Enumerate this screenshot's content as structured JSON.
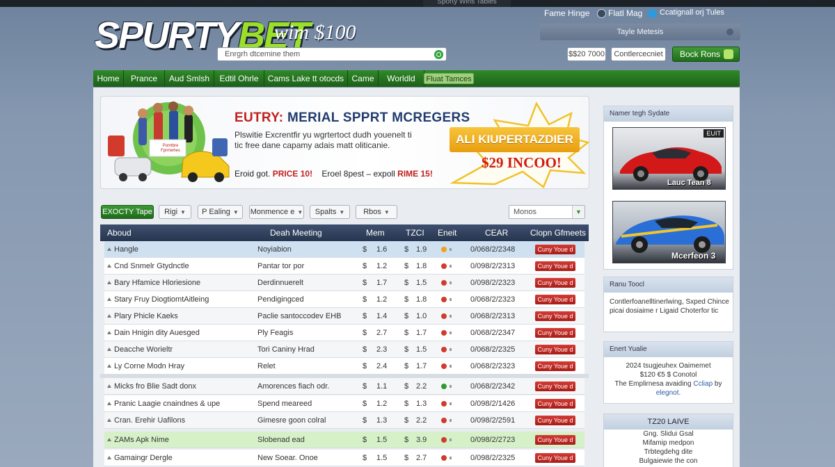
{
  "topstrip": {
    "label": "Sporty Wins Tables"
  },
  "header": {
    "logo_a": "SPURTY",
    "logo_b": "BET",
    "slogan": "wim $100",
    "search_placeholder": "Enrgrh dtcemine them",
    "links": [
      "Fame Hinge",
      "Flatl Mag",
      "Ccatignall orj Tules"
    ],
    "topbar_label": "Tayle Metesis",
    "amount_1": "$$20 7000",
    "amount_2": "Contlercecniet",
    "login_label": "Bock Rons"
  },
  "nav": [
    "Home",
    "Prance",
    "Aud Smlsh",
    "Edtil Ohrle",
    "Cams Lake tt otocds",
    "Came",
    "Worldld",
    "Fluat Tamces"
  ],
  "banner": {
    "title_a": "EUTRY:",
    "title_b": "MERIAL SPPRT MCREGERS",
    "text": "Plswitie Excrentfir yu wgrtertoct dudh youenelt ti tic free dane capamy adais matt oliticanie.",
    "price_a_label": "Eroid got.",
    "price_a": "PRICE 10!",
    "price_b_label": "Eroel 8pest – expoll",
    "price_b": "RIME 15!",
    "promo_tag": "ALI KIUPERTAZDIER",
    "promo_price": "$29 INCOO!",
    "mini_label": "Pomtbre Fprmwhes"
  },
  "filters": {
    "primary": "EXOCTY Tape",
    "buttons": [
      "Rigi",
      "P Ealing",
      "Monmence e",
      "Spalts",
      "Rbos"
    ],
    "search_value": "Monos"
  },
  "table": {
    "headers": [
      "Aboud",
      "Deah Meeting",
      "Mem",
      "TZCI",
      "Eneit",
      "CEAR",
      "Clopn Gfmeets"
    ],
    "bet_label": "Cuny Youe d",
    "rows": [
      {
        "name": "Hangle",
        "event": "Noyiabion",
        "mem": "1.6",
        "tzci": "1.9",
        "ear": "0/068/2/2348",
        "ico": "#f0a21e",
        "style": "highlight"
      },
      {
        "name": "Cnd Snmelr Gtydnctle",
        "event": "Pantar tor por",
        "mem": "1.2",
        "tzci": "1.8",
        "ear": "0/098/2/2313",
        "ico": "#d23a2e",
        "style": ""
      },
      {
        "name": "Bary Hfamice Hloriesione",
        "event": "Derdinnuerelt",
        "mem": "1.7",
        "tzci": "1.5",
        "ear": "0/098/2/2323",
        "ico": "#d23a2e",
        "style": "alt"
      },
      {
        "name": "Stary Fruy DiogtiomtAitleing",
        "event": "Pendigingced",
        "mem": "1.2",
        "tzci": "1.8",
        "ear": "0/068/2/2323",
        "ico": "#d23a2e",
        "style": ""
      },
      {
        "name": "Plary Phicle Kaeks",
        "event": "Paclie santoccodev EHB",
        "mem": "1.4",
        "tzci": "1.0",
        "ear": "0/068/2/2313",
        "ico": "#d23a2e",
        "style": "alt"
      },
      {
        "name": "Dain Hnigin dity Auesged",
        "event": "Ply Feagis",
        "mem": "2.7",
        "tzci": "1.7",
        "ear": "0/068/2/2347",
        "ico": "#d23a2e",
        "style": ""
      },
      {
        "name": "Deacche Worieltr",
        "event": "Tori Caniny Hrad",
        "mem": "2.3",
        "tzci": "1.5",
        "ear": "0/068/2/2325",
        "ico": "#d23a2e",
        "style": "alt"
      },
      {
        "name": "Ly Corne Modn Hray",
        "event": "Relet",
        "mem": "2.4",
        "tzci": "1.7",
        "ear": "0/068/2/2323",
        "ico": "#d23a2e",
        "style": ""
      },
      {
        "name": "Micks fro Blie Sadt donx",
        "event": "Amorences fiach odr.",
        "mem": "1.1",
        "tzci": "2.2",
        "ear": "0/068/2/2342",
        "ico": "#2f9a34",
        "style": "alt"
      },
      {
        "name": "Pranic Laagie cnaindnes & upe",
        "event": "Spend meareed",
        "mem": "1.2",
        "tzci": "1.3",
        "ear": "0/098/2/1426",
        "ico": "#d23a2e",
        "style": ""
      },
      {
        "name": "Cran. Erehir Uafilons",
        "event": "Gimesre goon colral",
        "mem": "1.3",
        "tzci": "2.2",
        "ear": "0/098/2/2591",
        "ico": "#d23a2e",
        "style": "alt"
      },
      {
        "name": "ZAMs Apk Nime",
        "event": "Slobenad ead",
        "mem": "1.5",
        "tzci": "3.9",
        "ear": "0/098/2/2723",
        "ico": "#d23a2e",
        "style": "green"
      },
      {
        "name": "Gamaingr Dergle",
        "event": "New Soear. Onoe",
        "mem": "1.5",
        "tzci": "2.7",
        "ear": "0/098/2/2325",
        "ico": "#d23a2e",
        "style": ""
      }
    ]
  },
  "sidebar": {
    "featured_title": "Namer tegh Sydate",
    "car1_tag": "EUIT",
    "car1_label": "Lauc Tean 8",
    "car2_label": "Mcerfeon 3",
    "card2_title": "Ranu Toocl",
    "card2_text": "Contlerfoanelltinerlwing, Sxped Chince picai dosiaime r Ligaid Choterfor tic",
    "card3_title": "Enert Yualie",
    "card3_text_a": "2024 tsugjeuhex Oaimemet",
    "card3_text_b": "$120 €5 $ Conotol",
    "card3_text_c": "The Emplirnesa avaiding",
    "card3_link_a": "Ccliap",
    "card3_text_d": "by",
    "card3_link_b": "elegnot.",
    "card4_title": "TZ20 LAIVE",
    "card4_lines": [
      "Gng. Slidui Gsal",
      "Mifamip medpon",
      "Trbtegdehg dite",
      "Bulgaiewie the con"
    ]
  },
  "colors": {
    "nav_green": "#2f8a2a",
    "table_header": "#3e4f6e",
    "bet_red": "#c02a24",
    "promo_orange": "#f0b32a"
  }
}
